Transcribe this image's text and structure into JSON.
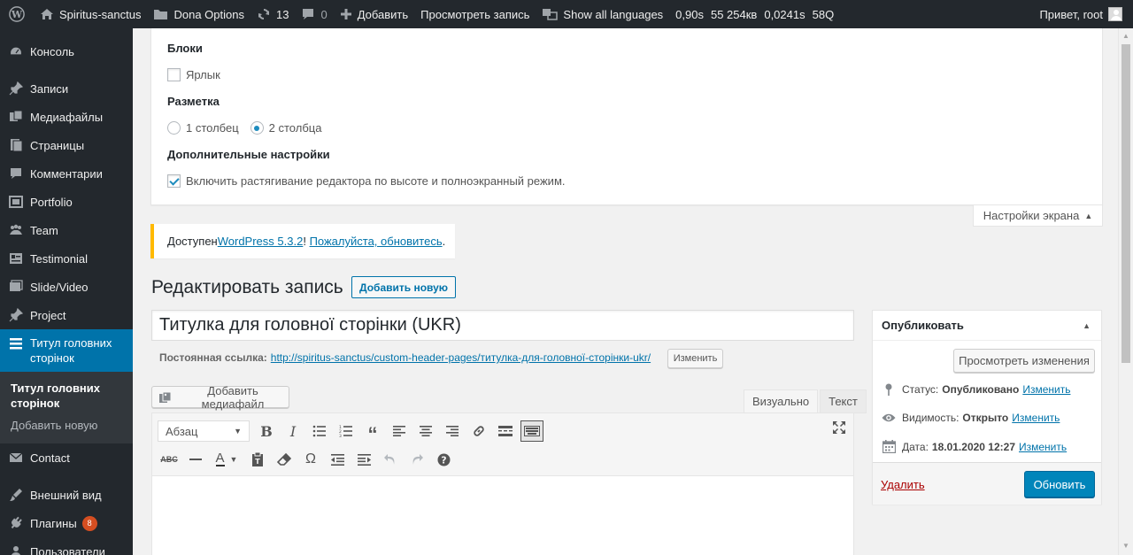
{
  "adminbar": {
    "site_name": "Spiritus-sanctus",
    "dona_options": "Dona Options",
    "updates_count": "13",
    "comments_count": "0",
    "add_new": "Добавить",
    "view_post": "Просмотреть запись",
    "show_languages": "Show all languages",
    "stat_time": "0,90s",
    "stat_memory": "55 254кв",
    "stat_query_time": "0,0241s",
    "stat_queries": "58Q",
    "greeting": "Привет, root"
  },
  "sidebar": {
    "items": [
      {
        "label": "Консоль",
        "icon": "dashboard-icon"
      },
      {
        "label": "Записи",
        "icon": "pin-icon"
      },
      {
        "label": "Медиафайлы",
        "icon": "media-icon"
      },
      {
        "label": "Страницы",
        "icon": "pages-icon"
      },
      {
        "label": "Комментарии",
        "icon": "comments-icon"
      },
      {
        "label": "Portfolio",
        "icon": "portfolio-icon"
      },
      {
        "label": "Team",
        "icon": "team-icon"
      },
      {
        "label": "Testimonial",
        "icon": "testimonial-icon"
      },
      {
        "label": "Slide/Video",
        "icon": "slide-icon"
      },
      {
        "label": "Project",
        "icon": "pin-icon"
      },
      {
        "label": "Титул головних сторінок",
        "icon": "header-pages-icon"
      },
      {
        "label": "Contact",
        "icon": "mail-icon"
      },
      {
        "label": "Внешний вид",
        "icon": "appearance-icon"
      },
      {
        "label": "Плагины",
        "icon": "plugins-icon",
        "badge": "8"
      },
      {
        "label": "Пользователи",
        "icon": "users-icon"
      }
    ],
    "submenu": [
      {
        "label": "Титул головних сторінок"
      },
      {
        "label": "Добавить новую"
      }
    ]
  },
  "screen_options": {
    "blocks_heading": "Блоки",
    "label_checkbox": "Ярлык",
    "layout_heading": "Разметка",
    "col1": "1 столбец",
    "col2": "2 столбца",
    "extra_heading": "Дополнительные настройки",
    "editor_expand": "Включить растягивание редактора по высоте и полноэкранный режим.",
    "tab_label": "Настройки экрана"
  },
  "update_nag": {
    "prefix": "Доступен ",
    "version_link": "WordPress 5.3.2",
    "middle": "! ",
    "update_link": "Пожалуйста, обновитесь",
    "suffix": "."
  },
  "page": {
    "title": "Редактировать запись",
    "add_new_button": "Добавить новую",
    "post_title": "Титулка для головної сторінки (UKR)",
    "permalink_label": "Постоянная ссылка:",
    "permalink_url": "http://spiritus-sanctus/custom-header-pages/титулка-для-головної-сторінки-ukr/",
    "permalink_edit": "Изменить"
  },
  "editor": {
    "add_media": "Добавить медиафайл",
    "tab_visual": "Визуально",
    "tab_text": "Текст",
    "format_select": "Абзац"
  },
  "publish": {
    "title": "Опубликовать",
    "preview_button": "Просмотреть изменения",
    "status_label": "Статус:",
    "status_value": "Опубликовано",
    "visibility_label": "Видимость:",
    "visibility_value": "Открыто",
    "date_label": "Дата:",
    "date_value": "18.01.2020 12:27",
    "edit_link": "Изменить",
    "delete_link": "Удалить",
    "update_button": "Обновить"
  },
  "colors": {
    "adminbar_bg": "#23282d",
    "accent": "#0073aa",
    "primary_button": "#0085ba",
    "notice_border": "#ffb900",
    "badge": "#d54e21"
  }
}
